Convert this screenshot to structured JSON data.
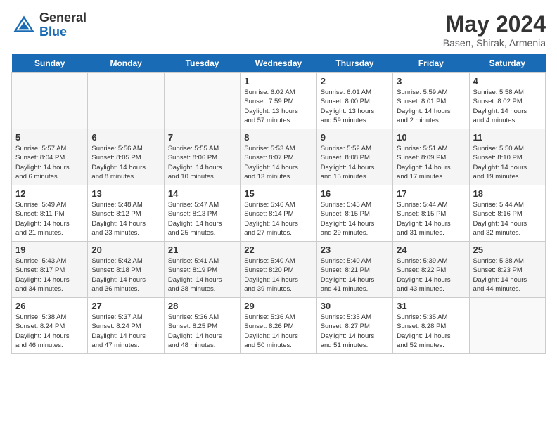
{
  "header": {
    "logo_general": "General",
    "logo_blue": "Blue",
    "month_title": "May 2024",
    "location": "Basen, Shirak, Armenia"
  },
  "calendar": {
    "days_of_week": [
      "Sunday",
      "Monday",
      "Tuesday",
      "Wednesday",
      "Thursday",
      "Friday",
      "Saturday"
    ],
    "weeks": [
      [
        {
          "day": "",
          "info": ""
        },
        {
          "day": "",
          "info": ""
        },
        {
          "day": "",
          "info": ""
        },
        {
          "day": "1",
          "info": "Sunrise: 6:02 AM\nSunset: 7:59 PM\nDaylight: 13 hours\nand 57 minutes."
        },
        {
          "day": "2",
          "info": "Sunrise: 6:01 AM\nSunset: 8:00 PM\nDaylight: 13 hours\nand 59 minutes."
        },
        {
          "day": "3",
          "info": "Sunrise: 5:59 AM\nSunset: 8:01 PM\nDaylight: 14 hours\nand 2 minutes."
        },
        {
          "day": "4",
          "info": "Sunrise: 5:58 AM\nSunset: 8:02 PM\nDaylight: 14 hours\nand 4 minutes."
        }
      ],
      [
        {
          "day": "5",
          "info": "Sunrise: 5:57 AM\nSunset: 8:04 PM\nDaylight: 14 hours\nand 6 minutes."
        },
        {
          "day": "6",
          "info": "Sunrise: 5:56 AM\nSunset: 8:05 PM\nDaylight: 14 hours\nand 8 minutes."
        },
        {
          "day": "7",
          "info": "Sunrise: 5:55 AM\nSunset: 8:06 PM\nDaylight: 14 hours\nand 10 minutes."
        },
        {
          "day": "8",
          "info": "Sunrise: 5:53 AM\nSunset: 8:07 PM\nDaylight: 14 hours\nand 13 minutes."
        },
        {
          "day": "9",
          "info": "Sunrise: 5:52 AM\nSunset: 8:08 PM\nDaylight: 14 hours\nand 15 minutes."
        },
        {
          "day": "10",
          "info": "Sunrise: 5:51 AM\nSunset: 8:09 PM\nDaylight: 14 hours\nand 17 minutes."
        },
        {
          "day": "11",
          "info": "Sunrise: 5:50 AM\nSunset: 8:10 PM\nDaylight: 14 hours\nand 19 minutes."
        }
      ],
      [
        {
          "day": "12",
          "info": "Sunrise: 5:49 AM\nSunset: 8:11 PM\nDaylight: 14 hours\nand 21 minutes."
        },
        {
          "day": "13",
          "info": "Sunrise: 5:48 AM\nSunset: 8:12 PM\nDaylight: 14 hours\nand 23 minutes."
        },
        {
          "day": "14",
          "info": "Sunrise: 5:47 AM\nSunset: 8:13 PM\nDaylight: 14 hours\nand 25 minutes."
        },
        {
          "day": "15",
          "info": "Sunrise: 5:46 AM\nSunset: 8:14 PM\nDaylight: 14 hours\nand 27 minutes."
        },
        {
          "day": "16",
          "info": "Sunrise: 5:45 AM\nSunset: 8:15 PM\nDaylight: 14 hours\nand 29 minutes."
        },
        {
          "day": "17",
          "info": "Sunrise: 5:44 AM\nSunset: 8:15 PM\nDaylight: 14 hours\nand 31 minutes."
        },
        {
          "day": "18",
          "info": "Sunrise: 5:44 AM\nSunset: 8:16 PM\nDaylight: 14 hours\nand 32 minutes."
        }
      ],
      [
        {
          "day": "19",
          "info": "Sunrise: 5:43 AM\nSunset: 8:17 PM\nDaylight: 14 hours\nand 34 minutes."
        },
        {
          "day": "20",
          "info": "Sunrise: 5:42 AM\nSunset: 8:18 PM\nDaylight: 14 hours\nand 36 minutes."
        },
        {
          "day": "21",
          "info": "Sunrise: 5:41 AM\nSunset: 8:19 PM\nDaylight: 14 hours\nand 38 minutes."
        },
        {
          "day": "22",
          "info": "Sunrise: 5:40 AM\nSunset: 8:20 PM\nDaylight: 14 hours\nand 39 minutes."
        },
        {
          "day": "23",
          "info": "Sunrise: 5:40 AM\nSunset: 8:21 PM\nDaylight: 14 hours\nand 41 minutes."
        },
        {
          "day": "24",
          "info": "Sunrise: 5:39 AM\nSunset: 8:22 PM\nDaylight: 14 hours\nand 43 minutes."
        },
        {
          "day": "25",
          "info": "Sunrise: 5:38 AM\nSunset: 8:23 PM\nDaylight: 14 hours\nand 44 minutes."
        }
      ],
      [
        {
          "day": "26",
          "info": "Sunrise: 5:38 AM\nSunset: 8:24 PM\nDaylight: 14 hours\nand 46 minutes."
        },
        {
          "day": "27",
          "info": "Sunrise: 5:37 AM\nSunset: 8:24 PM\nDaylight: 14 hours\nand 47 minutes."
        },
        {
          "day": "28",
          "info": "Sunrise: 5:36 AM\nSunset: 8:25 PM\nDaylight: 14 hours\nand 48 minutes."
        },
        {
          "day": "29",
          "info": "Sunrise: 5:36 AM\nSunset: 8:26 PM\nDaylight: 14 hours\nand 50 minutes."
        },
        {
          "day": "30",
          "info": "Sunrise: 5:35 AM\nSunset: 8:27 PM\nDaylight: 14 hours\nand 51 minutes."
        },
        {
          "day": "31",
          "info": "Sunrise: 5:35 AM\nSunset: 8:28 PM\nDaylight: 14 hours\nand 52 minutes."
        },
        {
          "day": "",
          "info": ""
        }
      ]
    ]
  }
}
